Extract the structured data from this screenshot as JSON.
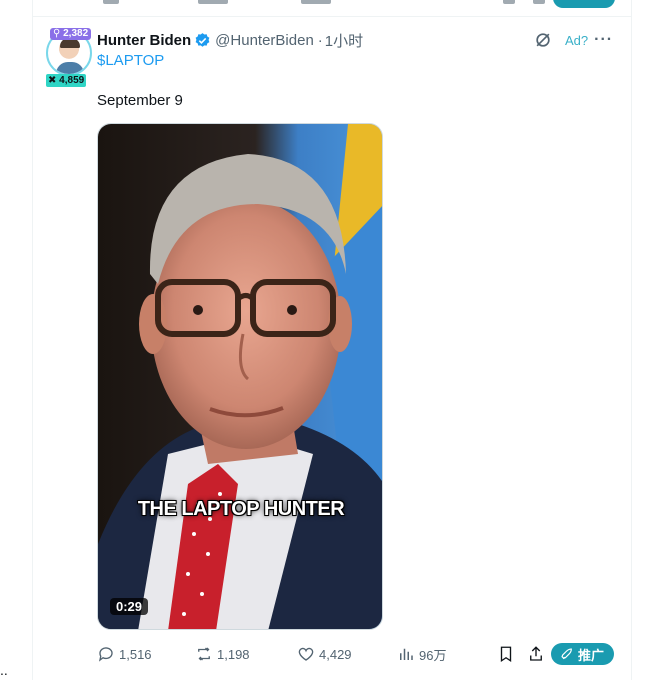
{
  "post": {
    "author_name": "Hunter Biden",
    "handle": "@HunterBiden",
    "separator": "·",
    "time": "1小时",
    "ticker": "$LAPTOP",
    "text": "September 9",
    "ad_label": "Ad?",
    "badges": {
      "top": "2,382",
      "bottom": "4,859"
    },
    "video": {
      "caption": "THE LAPTOP HUNTER",
      "duration": "0:29"
    }
  },
  "actions": {
    "replies": "1,516",
    "reposts": "1,198",
    "likes": "4,429",
    "views": "96万",
    "promote": "推广"
  },
  "colors": {
    "accent": "#1d9bf0",
    "promote_bg": "#1a9bb0",
    "muted": "#536471"
  },
  "icons": [
    "verified-icon",
    "grok-icon",
    "more-icon",
    "reply-icon",
    "repost-icon",
    "like-icon",
    "views-icon",
    "bookmark-icon",
    "share-icon",
    "rocket-icon"
  ]
}
